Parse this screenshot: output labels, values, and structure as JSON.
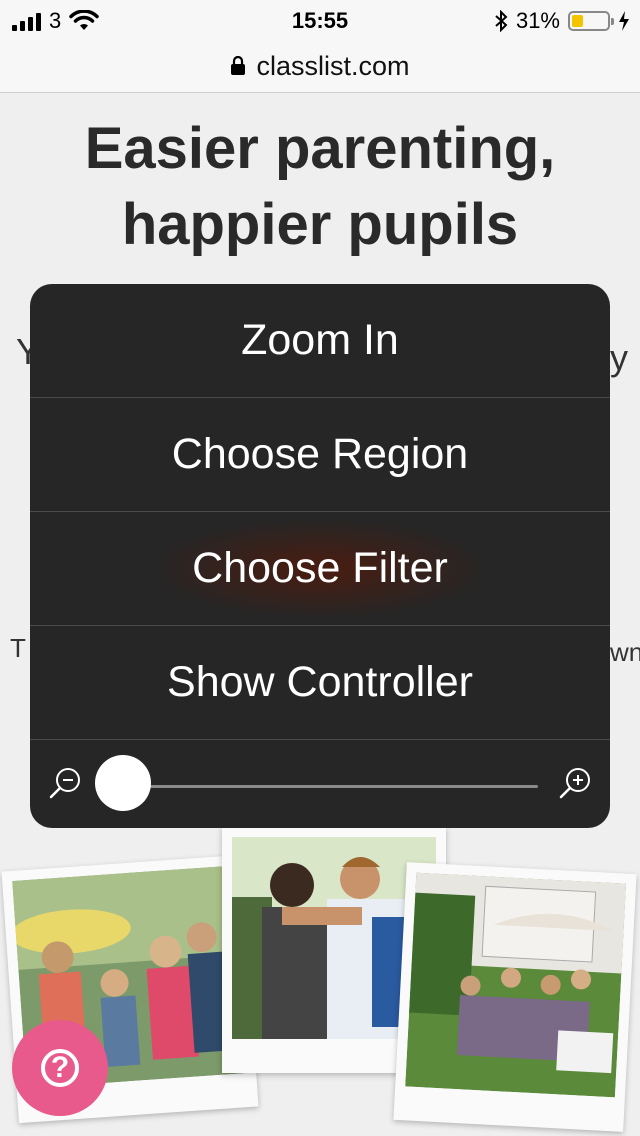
{
  "status_bar": {
    "carrier": "3",
    "time": "15:55",
    "battery_percent": "31%",
    "battery_level": 0.31,
    "battery_color": "#f5c400"
  },
  "url_bar": {
    "url": "classlist.com"
  },
  "page": {
    "headline_line1": "Easier parenting,",
    "headline_line2": "happier pupils",
    "peek_left": "Y",
    "peek_right": "y",
    "peek2_left": "T",
    "peek2_right": "wn"
  },
  "zoom_menu": {
    "items": [
      {
        "label": "Zoom In"
      },
      {
        "label": "Choose Region"
      },
      {
        "label": "Choose Filter"
      },
      {
        "label": "Show Controller"
      }
    ],
    "zoom_level": 0.0
  },
  "help_button": {
    "icon": "question-icon",
    "color": "#e85a8b"
  },
  "photos": [
    {
      "icon": "family-photo"
    },
    {
      "icon": "children-photo"
    },
    {
      "icon": "garden-party-photo"
    }
  ]
}
